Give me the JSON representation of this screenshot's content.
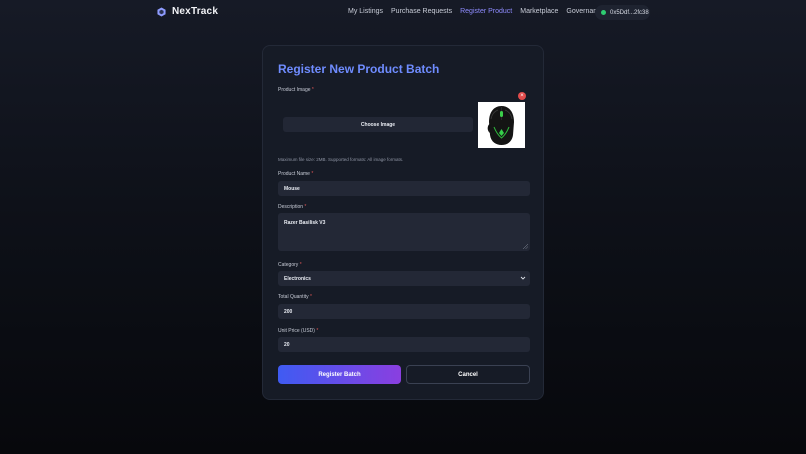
{
  "nav": {
    "brand": "NexTrack",
    "links": [
      "My Listings",
      "Purchase Requests",
      "Register Product",
      "Marketplace",
      "Governance"
    ],
    "active_link": "Register Product",
    "wallet": "0x5Ddf...2fc38"
  },
  "form": {
    "title": "Register New Product Batch",
    "image_label": "Product Image",
    "required_mark": "*",
    "choose_image": "Choose Image",
    "remove_icon": "×",
    "hint": "Maximum file size: 2MB. Supported formats: All image formats.",
    "name_label": "Product Name",
    "name_value": "Mouse",
    "description_label": "Description",
    "description_value": "Razer Basilisk V3",
    "category_label": "Category",
    "category_value": "Electronics",
    "quantity_label": "Total Quantity",
    "quantity_value": "200",
    "price_label": "Unit Price (USD)",
    "price_value": "20",
    "submit_label": "Register Batch",
    "cancel_label": "Cancel"
  },
  "colors": {
    "accent": "#6f8cff",
    "active_link": "#8f8cff",
    "required": "#e05656",
    "wallet_status": "#2ecc71",
    "submit_gradient_start": "#3f5bf2",
    "submit_gradient_end": "#8a3fe0"
  },
  "icons": {
    "brand": "hexagon-logo-icon",
    "wallet_status": "status-dot-icon",
    "remove": "close-icon",
    "select": "chevron-down-icon"
  }
}
